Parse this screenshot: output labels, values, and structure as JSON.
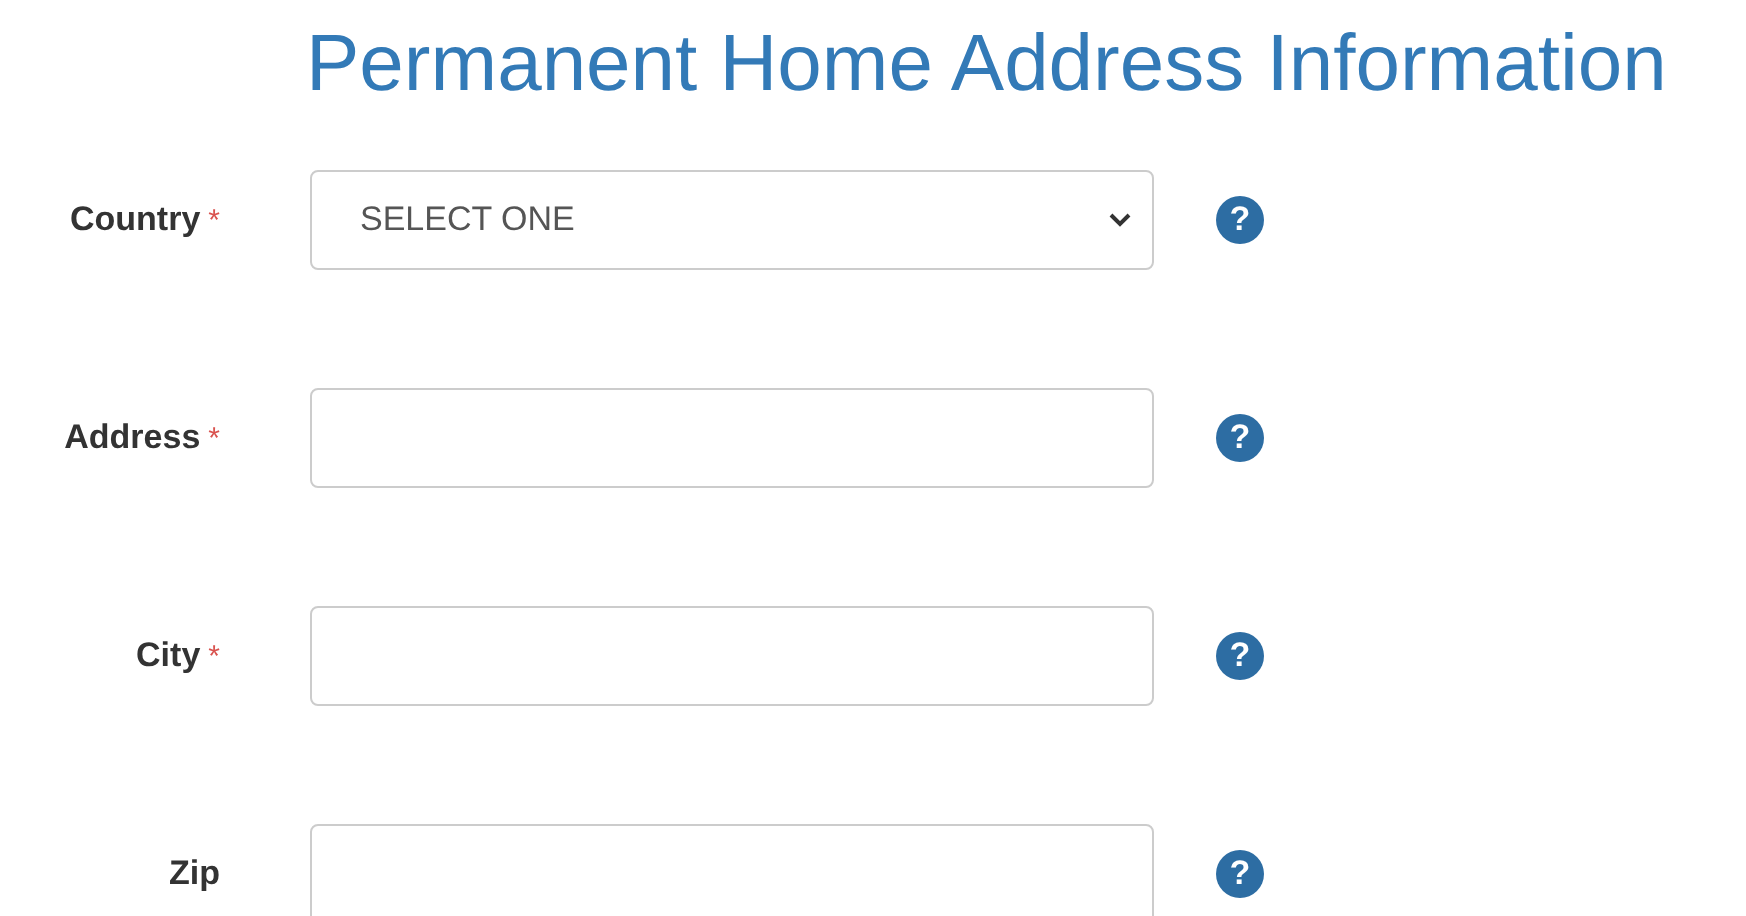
{
  "title": "Permanent Home Address Information",
  "fields": [
    {
      "label": "Country",
      "required": true,
      "required_mark": "*",
      "kind": "select",
      "value": "SELECT ONE",
      "help": "?"
    },
    {
      "label": "Address",
      "required": true,
      "required_mark": "*",
      "kind": "text",
      "help": "?"
    },
    {
      "label": "City",
      "required": true,
      "required_mark": "*",
      "kind": "text",
      "help": "?"
    },
    {
      "label": "Zip",
      "required": false,
      "kind": "text",
      "help": "?"
    }
  ]
}
